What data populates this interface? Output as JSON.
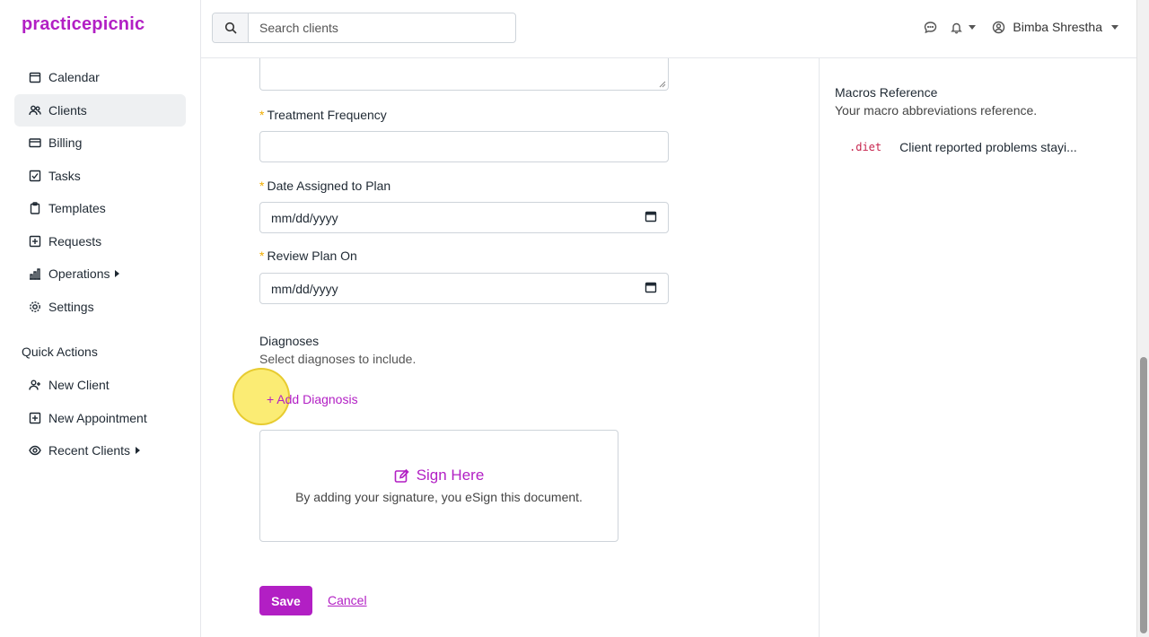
{
  "app": {
    "logo": "practicepicnic"
  },
  "sidebar": {
    "items": [
      {
        "label": "Calendar",
        "icon": "calendar-icon"
      },
      {
        "label": "Clients",
        "icon": "users-icon",
        "active": true
      },
      {
        "label": "Billing",
        "icon": "credit-card-icon"
      },
      {
        "label": "Tasks",
        "icon": "checkbox-icon"
      },
      {
        "label": "Templates",
        "icon": "clipboard-icon"
      },
      {
        "label": "Requests",
        "icon": "plus-square-icon"
      },
      {
        "label": "Operations",
        "icon": "bar-chart-icon"
      },
      {
        "label": "Settings",
        "icon": "gear-icon"
      }
    ],
    "quick_actions_title": "Quick Actions",
    "quick_actions": [
      {
        "label": "New Client",
        "icon": "user-plus-icon"
      },
      {
        "label": "New Appointment",
        "icon": "calendar-plus-icon"
      },
      {
        "label": "Recent Clients",
        "icon": "eye-icon"
      }
    ]
  },
  "header": {
    "search_placeholder": "Search clients",
    "user_name": "Bimba Shrestha"
  },
  "form": {
    "treatment_frequency_label": "Treatment Frequency",
    "treatment_frequency_value": "",
    "date_assigned_label": "Date Assigned to Plan",
    "date_assigned_value": "mm/dd/yyyy",
    "review_plan_label": "Review Plan On",
    "review_plan_value": "mm/dd/yyyy",
    "required_marker": "*",
    "diagnoses_title": "Diagnoses",
    "diagnoses_subtitle": "Select diagnoses to include.",
    "add_diagnosis": "+ Add Diagnosis",
    "sign_title": "Sign Here",
    "sign_subtitle": "By adding your signature, you eSign this document.",
    "save": "Save",
    "cancel": "Cancel"
  },
  "macros": {
    "title": "Macros Reference",
    "subtitle": "Your macro abbreviations reference.",
    "items": [
      {
        "code": ".diet",
        "text": "Client reported problems stayi..."
      }
    ]
  },
  "colors": {
    "accent": "#b21fc4",
    "required": "#f0ad00"
  }
}
